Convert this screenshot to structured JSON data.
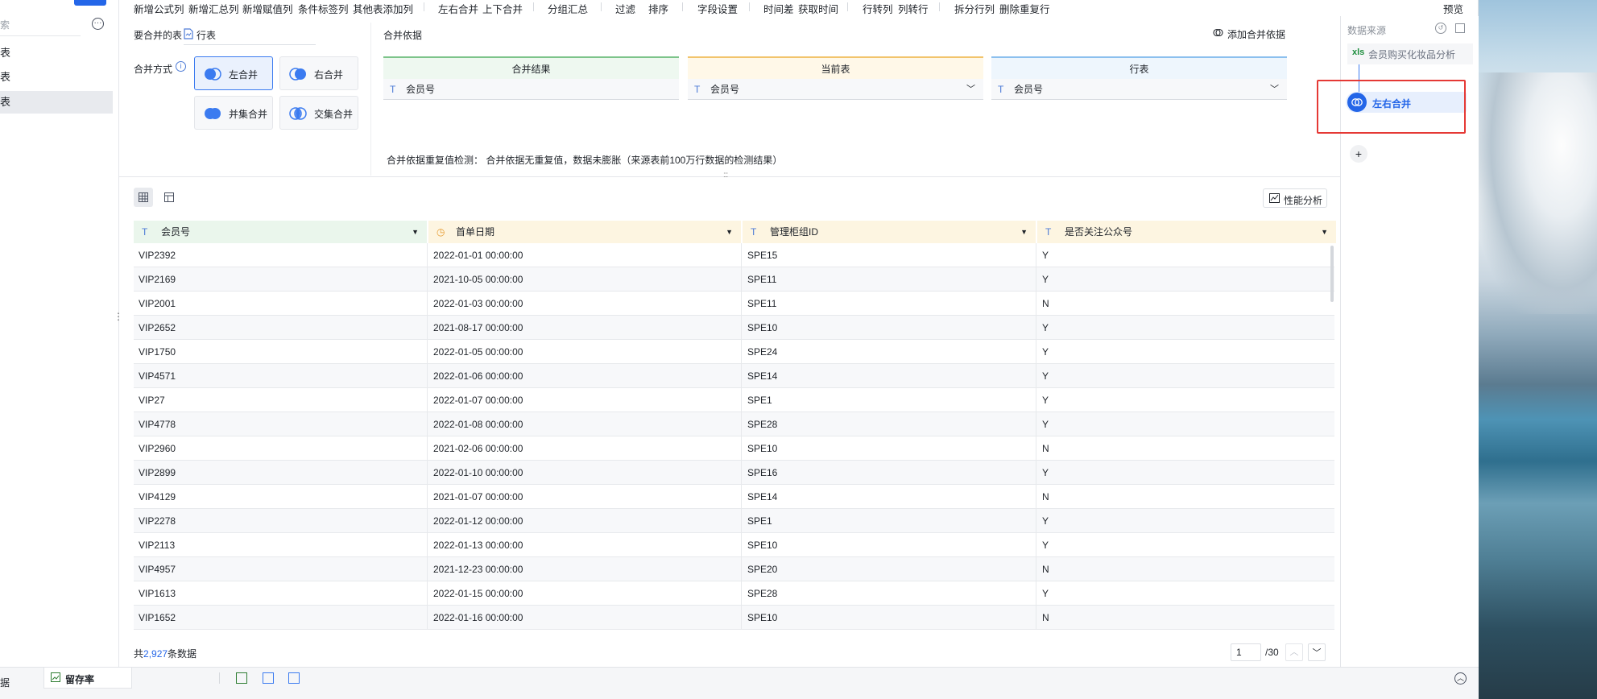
{
  "toolbar": {
    "groups": [
      [
        "新增公式列",
        "新增汇总列",
        "新增赋值列",
        "条件标签列",
        "其他表添加列"
      ],
      [
        "左右合并",
        "上下合并"
      ],
      [
        "分组汇总"
      ],
      [
        "过滤",
        "排序"
      ],
      [
        "字段设置"
      ],
      [
        "时间差",
        "获取时间"
      ],
      [
        "行转列",
        "列转行"
      ],
      [
        "拆分行列",
        "删除重复行"
      ]
    ],
    "preview": "预览"
  },
  "sidebar": {
    "search_placeholder": "索",
    "items": [
      {
        "label": "表",
        "active": false
      },
      {
        "label": "表",
        "active": false
      },
      {
        "label": "表",
        "active": true
      }
    ]
  },
  "config": {
    "table_to_merge_label": "要合并的表",
    "table_to_merge_value": "行表",
    "merge_method_label": "合并方式",
    "merge_options": [
      {
        "label": "左合并",
        "selected": true
      },
      {
        "label": "右合并",
        "selected": false
      },
      {
        "label": "并集合并",
        "selected": false
      },
      {
        "label": "交集合并",
        "selected": false
      }
    ],
    "basis_label": "合并依据",
    "add_basis": "添加合并依据",
    "columns": [
      {
        "header": "合并结果",
        "field": "会员号",
        "color": "#7dc48a",
        "bg": "#eef8f0",
        "has_dropdown": false
      },
      {
        "header": "当前表",
        "field": "会员号",
        "color": "#f2c46c",
        "bg": "#fff8e8",
        "has_dropdown": true
      },
      {
        "header": "行表",
        "field": "会员号",
        "color": "#8cc0ee",
        "bg": "#eef6fd",
        "has_dropdown": true
      }
    ],
    "check_text": "合并依据重复值检测：  合并依据无重复值，数据未膨胀（来源表前100万行数据的检测结果）"
  },
  "right_panel": {
    "title": "数据来源",
    "source_label": "会员购买化妆品分析",
    "node_label": "左右合并",
    "add_symbol": "+"
  },
  "grid": {
    "perf_button": "性能分析",
    "columns": [
      {
        "name": "会员号",
        "type_icon": "text-icon",
        "color": "#eaf6ec"
      },
      {
        "name": "首单日期",
        "type_icon": "clock-icon",
        "color": "#fdf5e1"
      },
      {
        "name": "管理柜组ID",
        "type_icon": "text-icon",
        "color": "#fdf5e1"
      },
      {
        "name": "是否关注公众号",
        "type_icon": "text-icon",
        "color": "#fdf5e1"
      }
    ],
    "rows": [
      [
        "VIP2392",
        "2022-01-01 00:00:00",
        "SPE15",
        "Y"
      ],
      [
        "VIP2169",
        "2021-10-05 00:00:00",
        "SPE11",
        "Y"
      ],
      [
        "VIP2001",
        "2022-01-03 00:00:00",
        "SPE11",
        "N"
      ],
      [
        "VIP2652",
        "2021-08-17 00:00:00",
        "SPE10",
        "Y"
      ],
      [
        "VIP1750",
        "2022-01-05 00:00:00",
        "SPE24",
        "Y"
      ],
      [
        "VIP4571",
        "2022-01-06 00:00:00",
        "SPE14",
        "Y"
      ],
      [
        "VIP27",
        "2022-01-07 00:00:00",
        "SPE1",
        "Y"
      ],
      [
        "VIP4778",
        "2022-01-08 00:00:00",
        "SPE28",
        "Y"
      ],
      [
        "VIP2960",
        "2021-02-06 00:00:00",
        "SPE10",
        "N"
      ],
      [
        "VIP2899",
        "2022-01-10 00:00:00",
        "SPE16",
        "Y"
      ],
      [
        "VIP4129",
        "2021-01-07 00:00:00",
        "SPE14",
        "N"
      ],
      [
        "VIP2278",
        "2022-01-12 00:00:00",
        "SPE1",
        "Y"
      ],
      [
        "VIP2113",
        "2022-01-13 00:00:00",
        "SPE10",
        "Y"
      ],
      [
        "VIP4957",
        "2021-12-23 00:00:00",
        "SPE20",
        "N"
      ],
      [
        "VIP1613",
        "2022-01-15 00:00:00",
        "SPE28",
        "Y"
      ],
      [
        "VIP1652",
        "2022-01-16 00:00:00",
        "SPE10",
        "N"
      ]
    ],
    "count_prefix": "共",
    "count_value": "2,927",
    "count_suffix": "条数据",
    "page_current": "1",
    "page_total": "/30"
  },
  "bottom": {
    "tab_left": "据",
    "tab_retention": "留存率"
  },
  "colors": {
    "accent": "#2466e8",
    "highlight_box": "#e53935"
  }
}
